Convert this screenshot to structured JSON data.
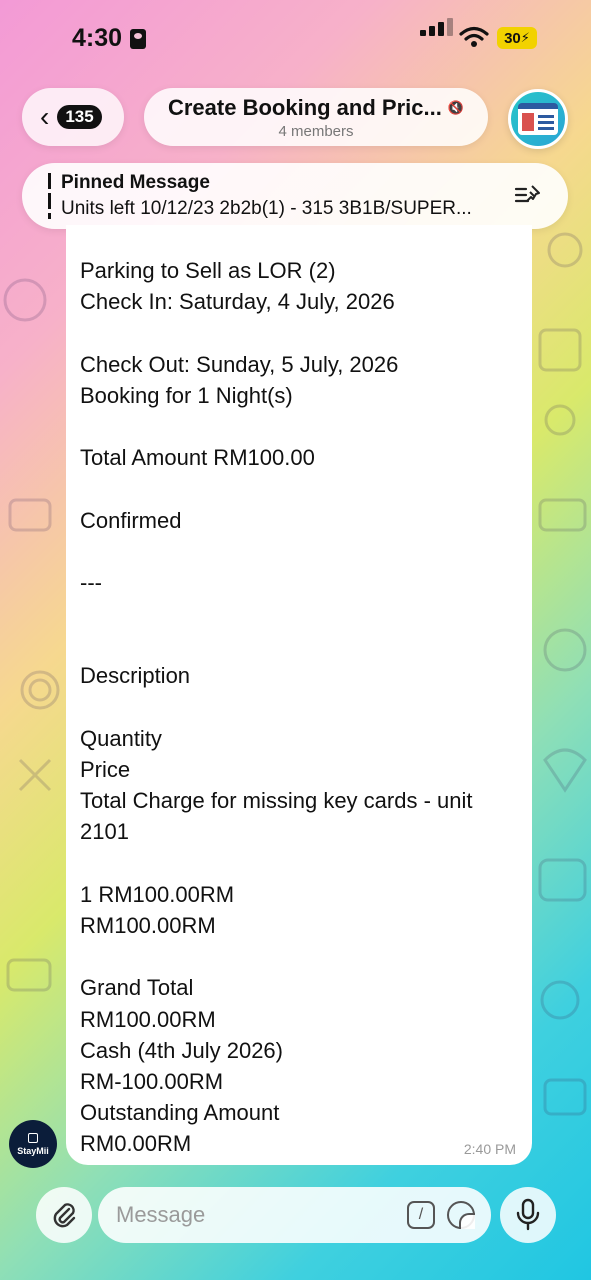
{
  "status_bar": {
    "time": "4:30",
    "battery": "30"
  },
  "header": {
    "back_count": "135",
    "title": "Create Booking and Pric...",
    "members": "4 members"
  },
  "pinned": {
    "label": "Pinned Message",
    "text": "Units left 10/12/23 2b2b(1) - 315 3B1B/SUPER..."
  },
  "message": {
    "lines": [
      "Parking to Sell as LOR (2)",
      "Check In: Saturday,  4 July, 2026",
      "",
      "Check Out: Sunday,  5 July, 2026",
      "Booking for 1 Night(s)",
      "",
      "Total Amount RM100.00",
      "",
      "Confirmed",
      "",
      "---",
      "",
      "",
      "Description",
      "",
      "Quantity",
      "Price",
      "Total Charge for missing key cards - unit",
      "2101",
      "",
      "1 RM100.00RM",
      "RM100.00RM",
      "",
      "Grand Total",
      "RM100.00RM",
      "Cash (4th July 2026)",
      "RM-100.00RM",
      "Outstanding Amount",
      "RM0.00RM"
    ],
    "time": "2:40 PM"
  },
  "bot_badge": {
    "label": "StayMii"
  },
  "composer": {
    "placeholder": "Message",
    "command_symbol": "/"
  },
  "icons": {
    "back": "chevron-left-icon",
    "mute": "muted-speaker-icon",
    "pin": "pin-list-icon",
    "attach": "paperclip-icon",
    "sticker": "sticker-icon",
    "mic": "microphone-icon"
  }
}
